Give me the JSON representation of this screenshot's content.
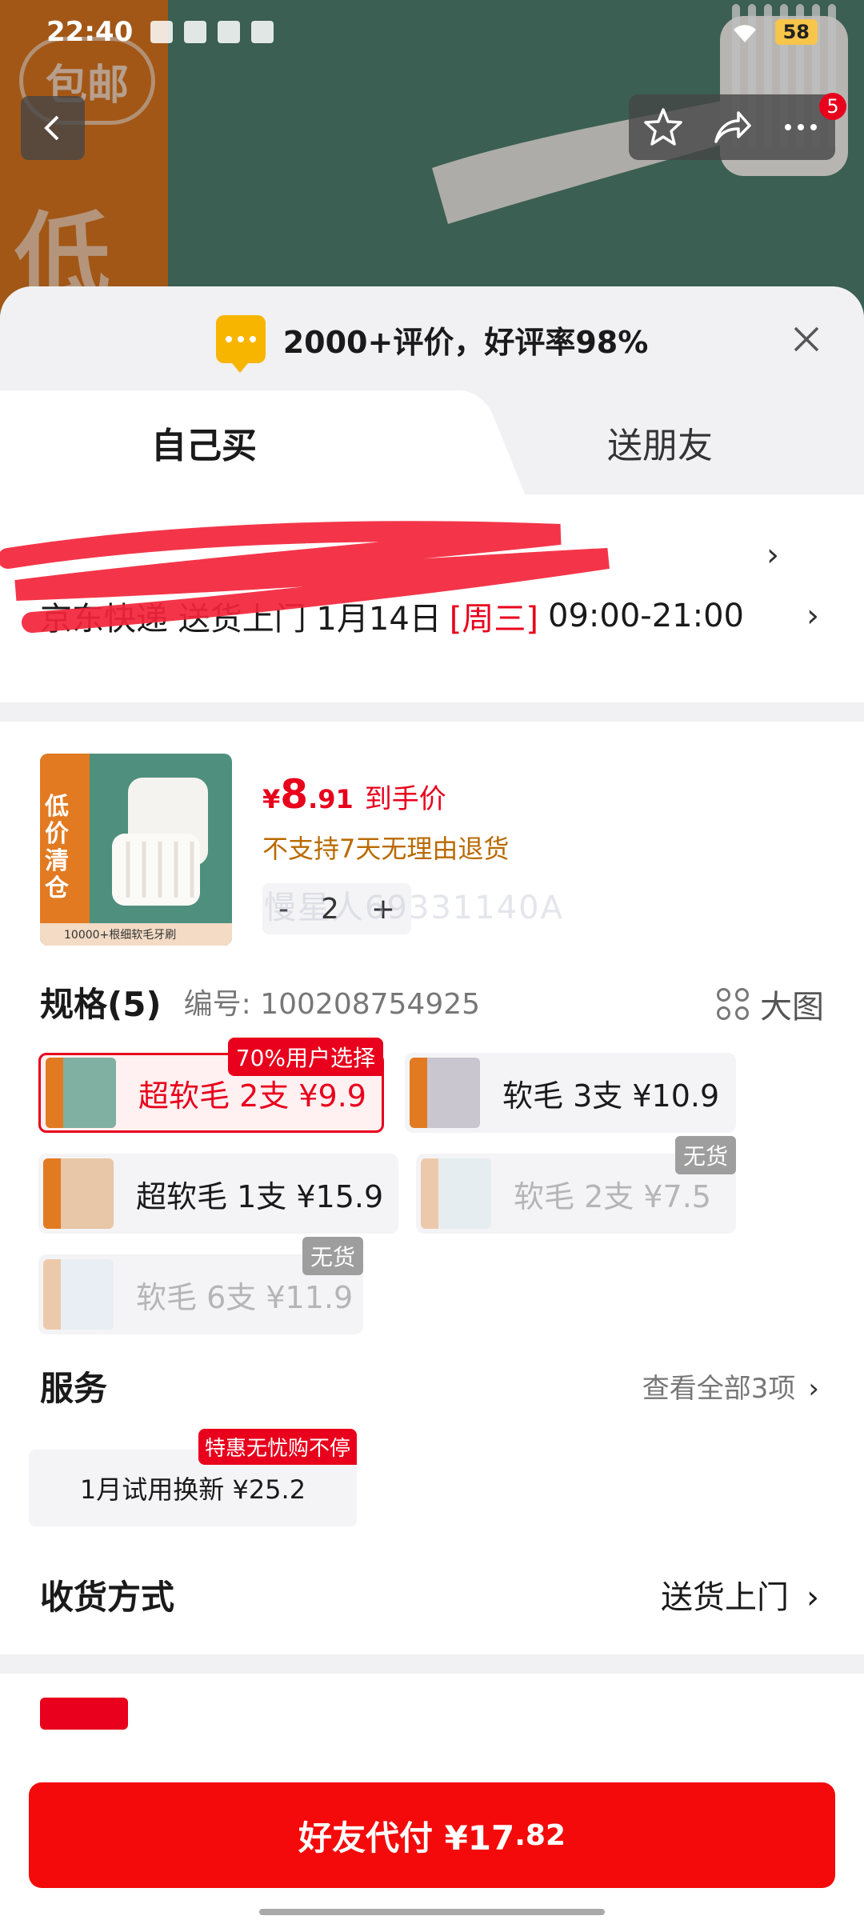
{
  "status_bar": {
    "time": "22:40",
    "battery": "58"
  },
  "hero": {
    "badge": "包邮",
    "big_char": "低"
  },
  "nav": {
    "cart_badge": "5"
  },
  "sheet": {
    "rating_text": "2000+评价，好评率98%",
    "tabs": {
      "self": "自己买",
      "friend": "送朋友"
    },
    "address": {
      "delivery_prefix": "京东快递 送货上门 1月14日",
      "weekday": "[周三]",
      "time_window": "09:00-21:00"
    },
    "product": {
      "thumb_text": "低价清仓",
      "thumb_foot": "10000+根细软毛牙刷",
      "price_symbol": "¥",
      "price_int": "8",
      "price_dec": ".91",
      "price_label": "到手价",
      "no_return": "不支持7天无理由退货",
      "quantity": "2",
      "minus": "-",
      "plus": "+",
      "watermark": "慢星人69331140A"
    },
    "spec": {
      "title": "规格(5)",
      "number": "编号: 100208754925",
      "big_pic": "大图",
      "options": [
        {
          "label": "超软毛 2支  ¥9.9",
          "tag": "70%用户选择",
          "selected": true,
          "available": true
        },
        {
          "label": "软毛 3支  ¥10.9",
          "available": true
        },
        {
          "label": "超软毛 1支  ¥15.9",
          "available": true
        },
        {
          "label": "软毛 2支  ¥7.5",
          "tag": "无货",
          "available": false
        },
        {
          "label": "软毛 6支  ¥11.9",
          "tag": "无货",
          "available": false
        }
      ]
    },
    "service": {
      "title": "服务",
      "view_all": "查看全部3项",
      "item": "1月试用换新  ¥25.2",
      "item_tag": "特惠无忧购不停"
    },
    "shipping": {
      "title": "收货方式",
      "value": "送货上门"
    }
  },
  "footer": {
    "pay_label": "好友代付 ¥17",
    "pay_cents": ".82"
  },
  "colors": {
    "accent": "#e8001c",
    "button": "#f40a0a",
    "warning": "#b96a00"
  }
}
